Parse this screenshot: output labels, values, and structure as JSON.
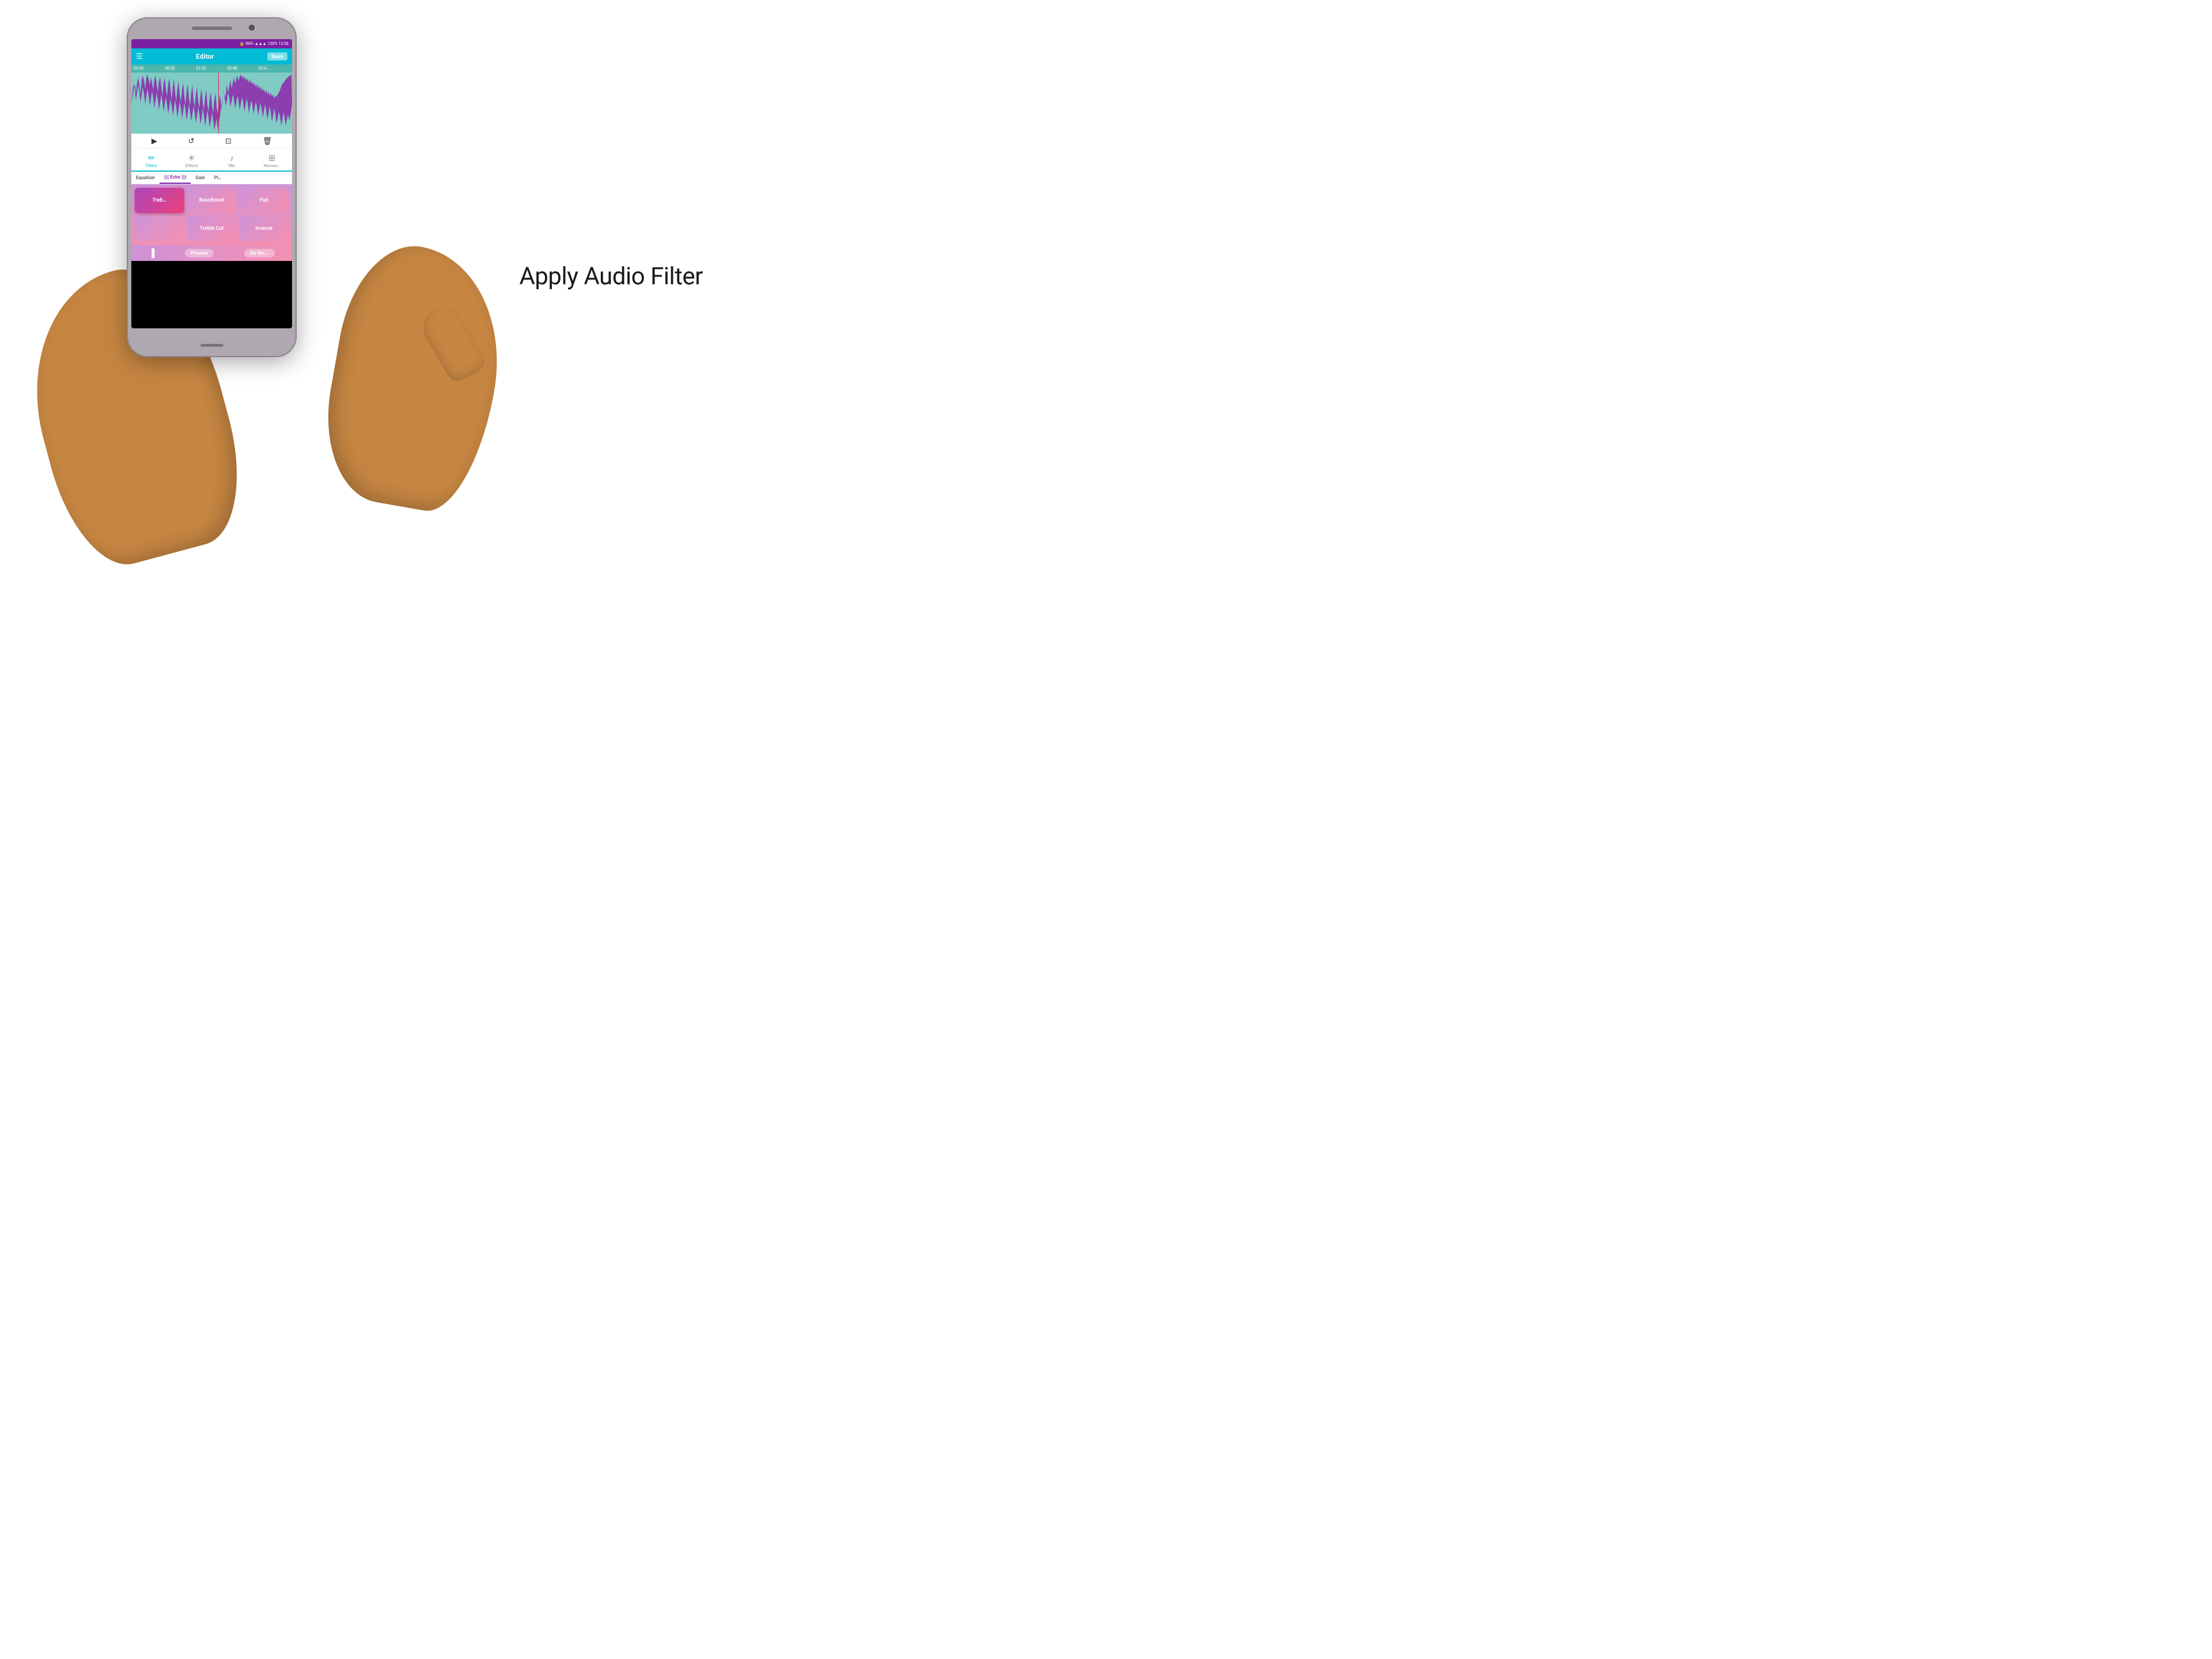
{
  "page": {
    "title": "Apply Audio Filter",
    "background": "#ffffff"
  },
  "status_bar": {
    "time": "13:56",
    "battery": "100%",
    "signal": "▲▲▲",
    "wifi": "WiFi",
    "lock": "🔒"
  },
  "app_bar": {
    "menu_icon": "☰",
    "title": "Editor",
    "save_label": "Save"
  },
  "timeline": {
    "markers": [
      "00:00",
      "00:56",
      "01:52",
      "02:48",
      "03:4…"
    ]
  },
  "transport": {
    "play_icon": "▶",
    "undo_icon": "↺",
    "crop_icon": "⊡",
    "delete_icon": "🗑"
  },
  "tabs": [
    {
      "id": "filters",
      "icon": "✏",
      "label": "Filters",
      "active": true
    },
    {
      "id": "effects",
      "icon": "✳",
      "label": "Effects",
      "active": false
    },
    {
      "id": "mix",
      "icon": "♪",
      "label": "Mix",
      "active": false
    },
    {
      "id": "moment",
      "icon": "⊞",
      "label": "Momen…",
      "active": false
    }
  ],
  "sub_nav": [
    {
      "id": "equalizer",
      "label": "Equalizer",
      "active": false
    },
    {
      "id": "echo",
      "label": "((( Echo )))",
      "active": true
    },
    {
      "id": "gain",
      "label": "Gain",
      "active": false
    },
    {
      "id": "pitch",
      "label": "Pi…",
      "active": false
    }
  ],
  "filter_cells": [
    {
      "id": "treb",
      "label": "Treb…",
      "selected": true
    },
    {
      "id": "bassboost",
      "label": "BassBoost",
      "selected": false
    },
    {
      "id": "flat",
      "label": "Flat",
      "selected": false
    },
    {
      "id": "empty",
      "label": "",
      "selected": false
    },
    {
      "id": "treblecut",
      "label": "Treble Cut",
      "selected": false
    },
    {
      "id": "inverse",
      "label": "Inverse",
      "selected": false
    }
  ],
  "bottom_bar": {
    "chart_icon": "▐",
    "preview_label": "Preview",
    "domore_label": "Do Mo…"
  }
}
